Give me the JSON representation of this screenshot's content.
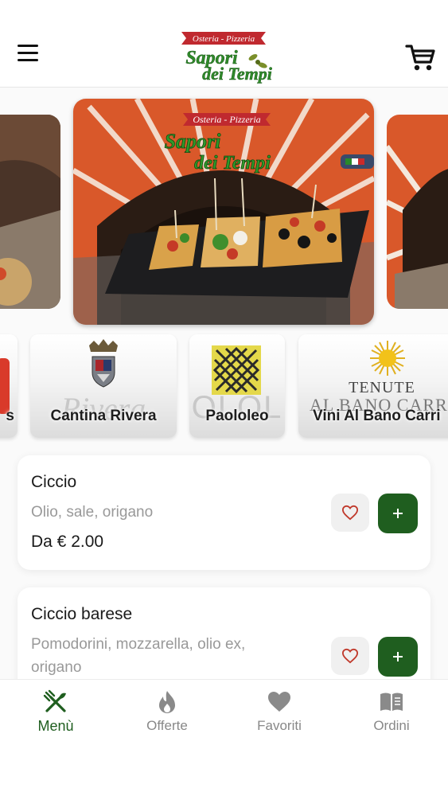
{
  "header": {
    "logo_top": "Osteria - Pizzeria",
    "logo_line1": "Sapori",
    "logo_line2": "dei Tempi"
  },
  "carousel": {
    "slide_logo_top": "Osteria - Pizzeria",
    "slide_logo_line1": "Sapori",
    "slide_logo_line2": "dei Tempi"
  },
  "brands": [
    {
      "label": "s"
    },
    {
      "label": "Cantina Rivera",
      "bg_text": "Rivera"
    },
    {
      "label": "Paololeo",
      "bg_text": "OLOL"
    },
    {
      "label": "Vini Al Bano Carri",
      "logo_text1": "TENUTE",
      "logo_text2": "AL BANO CARRI"
    }
  ],
  "products": [
    {
      "name": "Ciccio",
      "description": "Olio, sale, origano",
      "price": "Da € 2.00"
    },
    {
      "name": "Ciccio barese",
      "description_line1": "Pomodorini, mozzarella, olio ex,",
      "description_line2": "origano"
    }
  ],
  "bottom_nav": [
    {
      "label": "Menù",
      "icon": "cutlery-icon",
      "active": true
    },
    {
      "label": "Offerte",
      "icon": "flame-icon"
    },
    {
      "label": "Favoriti",
      "icon": "heart-icon"
    },
    {
      "label": "Ordini",
      "icon": "book-icon"
    }
  ],
  "colors": {
    "accent": "#1f5e1f",
    "heart": "#c0392b",
    "muted": "#999999"
  }
}
